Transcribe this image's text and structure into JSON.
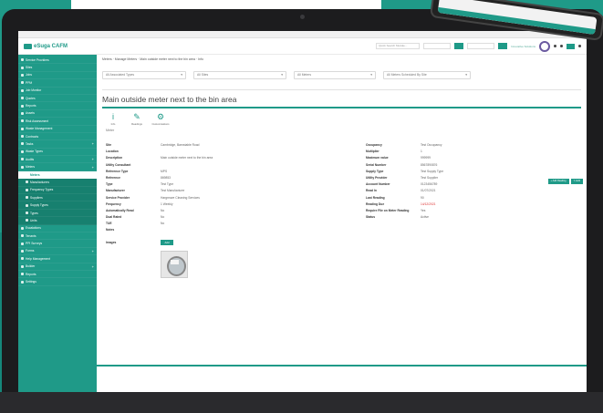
{
  "app": {
    "logo_text": "eSuga CAFM",
    "partner_text": "Innovative Solutions"
  },
  "header": {
    "search_placeholder": "Quick Search Module..."
  },
  "sidebar": {
    "items": [
      {
        "label": "Service Providers"
      },
      {
        "label": "Sites"
      },
      {
        "label": "Jobs"
      },
      {
        "label": "PPM"
      },
      {
        "label": "Job Monitor"
      },
      {
        "label": "Quotes"
      },
      {
        "label": "Reports"
      },
      {
        "label": "Assets"
      },
      {
        "label": "Risk Assessment"
      },
      {
        "label": "Waste Management"
      },
      {
        "label": "Contracts"
      },
      {
        "label": "Tasks",
        "plus": "+"
      },
      {
        "label": "Waste Types"
      },
      {
        "label": "Audits",
        "plus": "+"
      },
      {
        "label": "Meters",
        "plus": "+"
      }
    ],
    "meters_sub": [
      {
        "label": "Meters",
        "active": true
      },
      {
        "label": "Manufacturers"
      },
      {
        "label": "Frequency Types"
      },
      {
        "label": "Suppliers"
      },
      {
        "label": "Supply Types"
      },
      {
        "label": "Types"
      },
      {
        "label": "Units"
      }
    ],
    "items_after": [
      {
        "label": "Escalations"
      },
      {
        "label": "Tenants"
      },
      {
        "label": "PPI Surveys"
      },
      {
        "label": "Forms",
        "plus": "+"
      },
      {
        "label": "Help Management"
      },
      {
        "label": "Builder",
        "plus": "+"
      },
      {
        "label": "Reports"
      },
      {
        "label": "Settings"
      }
    ]
  },
  "breadcrumb": "Meters · Manage Meters · Main outside meter next to the bin area · Info",
  "filters": [
    {
      "value": "All Associated Types"
    },
    {
      "value": "All Sites"
    },
    {
      "value": "All Meters"
    },
    {
      "value": "All Meters Scheduled By Site"
    }
  ],
  "meter": {
    "title": "Main outside meter next to the bin area",
    "sub": "Meter"
  },
  "actions": [
    {
      "glyph": "i",
      "label": "Info"
    },
    {
      "glyph": "✎",
      "label": "Readings"
    },
    {
      "glyph": "⚙",
      "label": "Customisations"
    }
  ],
  "right_buttons": [
    {
      "label": "+ Add Reading"
    },
    {
      "label": "✎ Edit"
    }
  ],
  "details_left": [
    {
      "label": "Site",
      "value": "Cambridge, Barnstable Road"
    },
    {
      "label": "Location",
      "value": ""
    },
    {
      "label": "Description",
      "value": "Main outside meter next to the bin area"
    },
    {
      "label": "Utility Consultant",
      "value": ""
    },
    {
      "label": "Reference Type",
      "value": "MPS"
    },
    {
      "label": "Reference",
      "value": "869853"
    },
    {
      "label": "Type",
      "value": "Test Type"
    },
    {
      "label": "Manufacturer",
      "value": "Test Manufacturer"
    },
    {
      "label": "Service Provider",
      "value": "Hargreave Cleaning Services"
    },
    {
      "label": "Frequency",
      "value": "1 Weekly"
    },
    {
      "label": "Automatically Read",
      "value": "No"
    },
    {
      "label": "Dual Rated",
      "value": "No"
    },
    {
      "label": "TUE",
      "value": "No"
    },
    {
      "label": "Notes",
      "value": ""
    }
  ],
  "details_right": [
    {
      "label": "Occupancy",
      "value": "Test Occupancy"
    },
    {
      "label": "Multiplier",
      "value": "1"
    },
    {
      "label": "Maximum value",
      "value": "999999"
    },
    {
      "label": "Serial Number",
      "value": "8567890876"
    },
    {
      "label": "Supply Type",
      "value": "Test Supply Type"
    },
    {
      "label": "Utility Provider",
      "value": "Test Supplier"
    },
    {
      "label": "Account Number",
      "value": "0123456789"
    },
    {
      "label": "Read In",
      "value": "01/07/2021"
    },
    {
      "label": "Last Reading",
      "value": "90"
    },
    {
      "label": "Reading Due",
      "value": "14/12/2021",
      "red": true
    },
    {
      "label": "Require File on Meter Reading",
      "value": "Yes"
    },
    {
      "label": "Status",
      "value": "Active"
    }
  ],
  "images": {
    "label": "Images",
    "add_label": "Add"
  },
  "colors": {
    "accent": "#1f9a88",
    "danger": "#d33333"
  }
}
